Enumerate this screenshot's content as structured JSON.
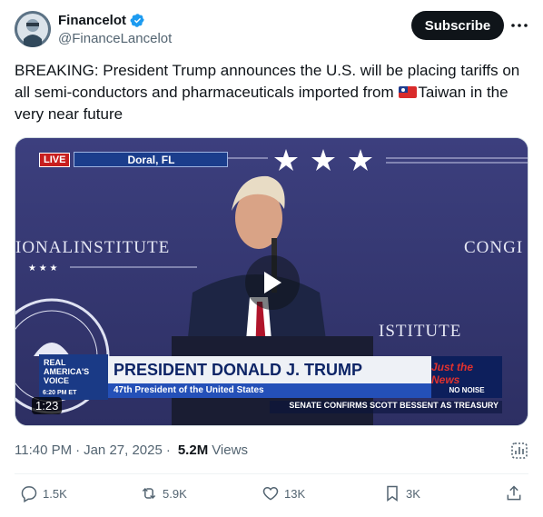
{
  "author": {
    "display_name": "Financelot",
    "handle": "@FinanceLancelot",
    "verified": true
  },
  "subscribe_label": "Subscribe",
  "tweet": {
    "text_before_flag": "BREAKING: President Trump announces the U.S. will be placing tariffs on all semi-conductors and pharmaceuticals imported from ",
    "flag_icon": "taiwan-flag-icon",
    "text_after_flag": "Taiwan in the very near future"
  },
  "video": {
    "live_badge": "LIVE",
    "location": "Doral, FL",
    "backdrop_left": "IONALINSTITUTE",
    "backdrop_right": "CONGI",
    "backdrop_podium": "ISTITUTE",
    "logo_line1": "REAL",
    "logo_line2": "AMERICA'S",
    "logo_line3": "VOICE",
    "logo_time": "6:20 PM ET",
    "lower_third_name": "PRESIDENT DONALD J. TRUMP",
    "lower_third_title": "47th President of the United States",
    "brand_line1": "Just the News",
    "brand_line2": "NO NOISE",
    "ticker": "SENATE CONFIRMS SCOTT BESSENT AS TREASURY",
    "duration": "1:23"
  },
  "meta": {
    "time": "11:40 PM",
    "date": "Jan 27, 2025",
    "views_count": "5.2M",
    "views_label": "Views"
  },
  "actions": {
    "replies": "1.5K",
    "reposts": "5.9K",
    "likes": "13K",
    "bookmarks": "3K"
  },
  "colors": {
    "accent": "#1d9bf0",
    "text_primary": "#0f1419",
    "text_secondary": "#536471",
    "subscribe_bg": "#0f1419"
  }
}
